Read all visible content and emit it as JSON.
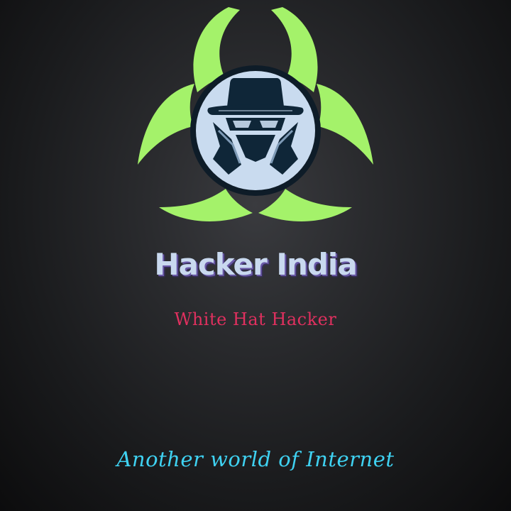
{
  "brand": {
    "title": "Hacker India",
    "subtitle": "White Hat Hacker",
    "tagline": "Another world of Internet"
  },
  "colors": {
    "background": "#1e1f22",
    "biohazard": "#a4f26a",
    "badge_fill": "#c9dbef",
    "badge_ring": "#0e1c28",
    "figure": "#0f2638",
    "title": "#c9d9ef",
    "subtitle": "#e0305f",
    "tagline": "#3fd2f2"
  },
  "icons": [
    "biohazard-icon",
    "spy-hat-icon"
  ]
}
